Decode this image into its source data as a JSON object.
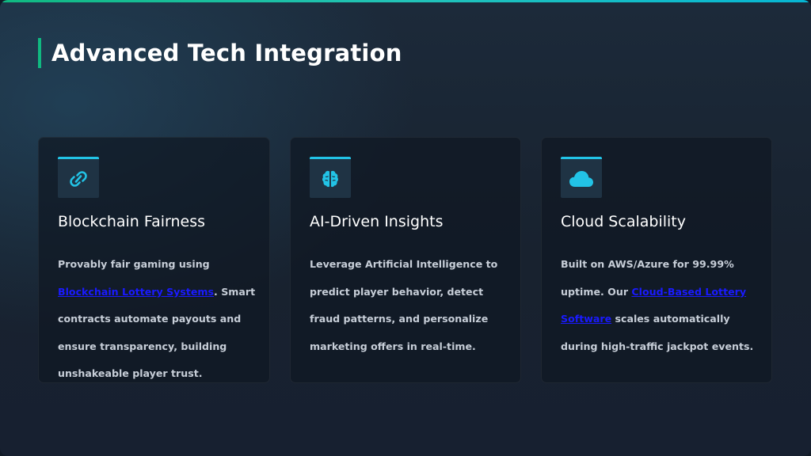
{
  "slide": {
    "title": "Advanced Tech Integration",
    "colors": {
      "accent_green": "#10b981",
      "accent_cyan": "#22c3e6",
      "link_blue": "#1a1aff"
    }
  },
  "cards": [
    {
      "icon": "link-icon",
      "title": "Blockchain Fairness",
      "body_before": "Provably fair gaming using ",
      "link": "Blockchain Lottery Systems",
      "body_after": ". Smart contracts automate payouts and ensure transparency, building unshakeable player trust."
    },
    {
      "icon": "brain-icon",
      "title": "AI-Driven Insights",
      "body": "Leverage Artificial Intelligence to predict player behavior, detect fraud patterns, and personalize marketing offers in real-time."
    },
    {
      "icon": "cloud-icon",
      "title": "Cloud Scalability",
      "body_before": "Built on AWS/Azure for 99.99% uptime. Our ",
      "link": "Cloud-Based Lottery Software",
      "body_after": " scales automatically during high-traffic jackpot events."
    }
  ]
}
